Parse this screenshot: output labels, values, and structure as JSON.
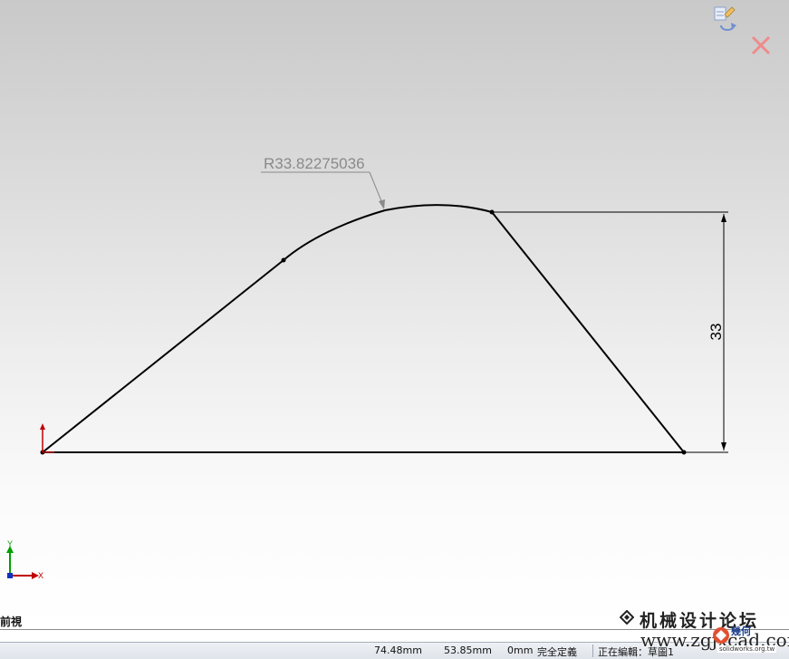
{
  "dimensions": {
    "radius_label": "R33.82275036",
    "height_label": "33"
  },
  "triad": {
    "x_label": "X",
    "y_label": "Y"
  },
  "view": {
    "orientation_label": "前視"
  },
  "status": {
    "x_coord": "74.48mm",
    "y_coord": "53.85mm",
    "z_coord": "0mm",
    "definition_state": "完全定義",
    "editing": "正在編輯：草圖1"
  },
  "watermark": {
    "title": "机械设计论坛",
    "url": "www.zgjxcad.com",
    "badge": "幾何",
    "sub": "solidworks.org.tw"
  },
  "icons": {
    "confirm": "sketch-confirm-corner-icon",
    "cancel": "close-icon"
  },
  "colors": {
    "sketch_line": "#000000",
    "dimension": "#000000",
    "radius_dim": "#8a8a8a",
    "origin": "#c00000",
    "triad_x": "#c00000",
    "triad_y": "#00a000",
    "triad_z": "#1030c0"
  }
}
